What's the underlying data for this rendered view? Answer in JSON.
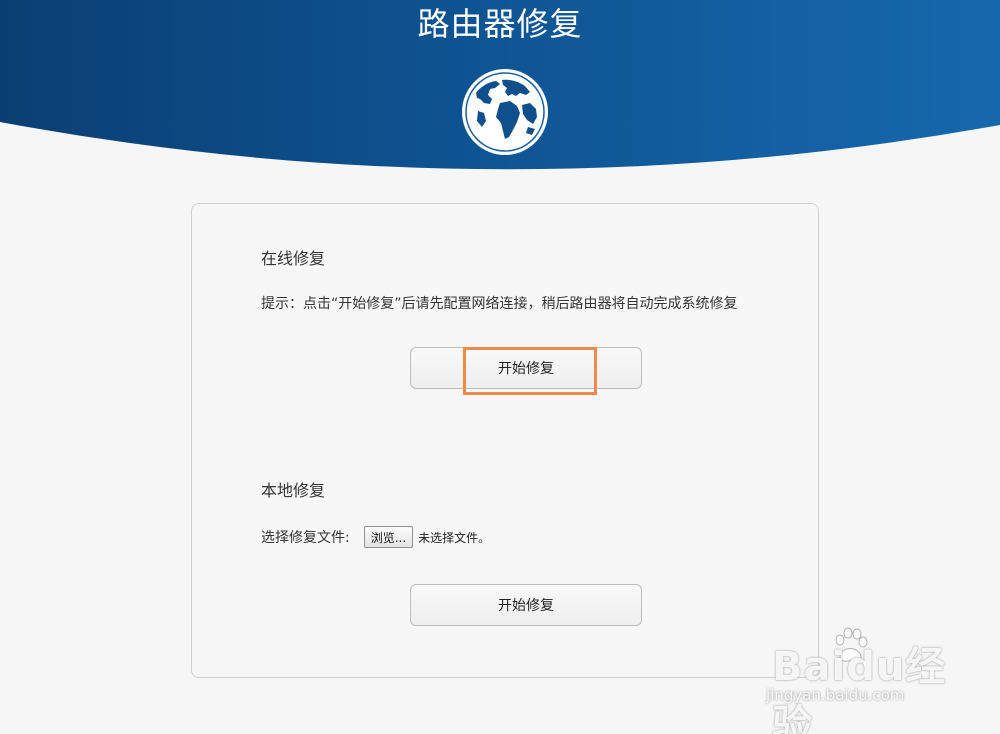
{
  "header": {
    "title": "路由器修复"
  },
  "online_repair": {
    "title": "在线修复",
    "hint": "提示：点击“开始修复”后请先配置网络连接，稍后路由器将自动完成系统修复",
    "start_button_label": "开始修复"
  },
  "local_repair": {
    "title": "本地修复",
    "file_label": "选择修复文件:",
    "browse_button_label": "浏览...",
    "no_file_text": "未选择文件。",
    "start_button_label": "开始修复"
  },
  "watermark": {
    "brand": "Baidu经验",
    "url": "jingyan.baidu.com"
  },
  "colors": {
    "header_dark": "#0a3f73",
    "header_light": "#1668ad",
    "highlight": "#f08a4b"
  }
}
